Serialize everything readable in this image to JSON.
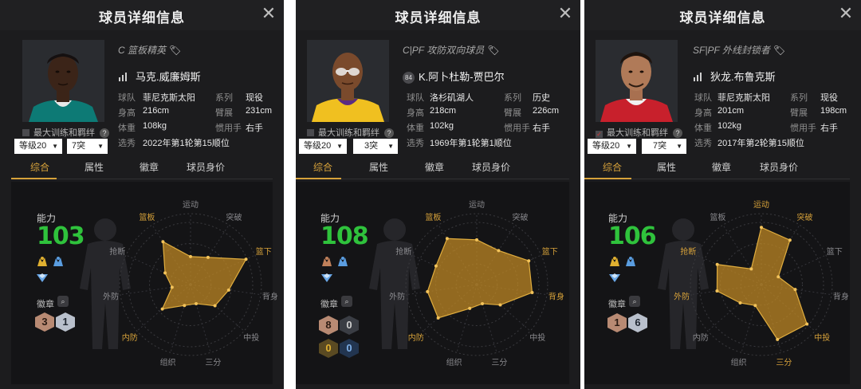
{
  "panels": [
    {
      "title": "球员详细信息",
      "position_line": "C 篮板精英",
      "name": "马克.威廉姆斯",
      "jersey_number": "",
      "info": {
        "team_label": "球队",
        "team": "菲尼克斯太阳",
        "series_label": "系列",
        "series": "现役",
        "height_label": "身高",
        "height": "216cm",
        "wingspan_label": "臂展",
        "wingspan": "231cm",
        "weight_label": "体重",
        "weight": "108kg",
        "hand_label": "惯用手",
        "hand": "右手",
        "draft_label": "选秀",
        "draft": "2022年第1轮第15顺位"
      },
      "training_label": "最大训练和羁绊",
      "training_checked": false,
      "level_select": "等级20",
      "break_select": "7突",
      "tabs": [
        "综合",
        "属性",
        "徽章",
        "球员身价"
      ],
      "ability_label": "能力",
      "ability": "103",
      "badges_label": "徽章",
      "badge_counts": [
        "3",
        "1"
      ],
      "radar": {
        "labels": [
          "运动",
          "突破",
          "篮下",
          "背身",
          "中投",
          "三分",
          "组织",
          "内防",
          "外防",
          "抢断",
          "篮板"
        ],
        "highlighted": [
          "篮下",
          "内防",
          "篮板"
        ],
        "values": [
          0.45,
          0.52,
          0.98,
          0.62,
          0.52,
          0.32,
          0.35,
          0.6,
          0.3,
          0.45,
          0.82
        ]
      }
    },
    {
      "title": "球员详细信息",
      "position_line": "C|PF 攻防双向球员",
      "name": "K.阿卜杜勒-贾巴尔",
      "jersey_number": "84",
      "info": {
        "team_label": "球队",
        "team": "洛杉矶湖人",
        "series_label": "系列",
        "series": "历史",
        "height_label": "身高",
        "height": "218cm",
        "wingspan_label": "臂展",
        "wingspan": "226cm",
        "weight_label": "体重",
        "weight": "102kg",
        "hand_label": "惯用手",
        "hand": "右手",
        "draft_label": "选秀",
        "draft": "1969年第1轮第1顺位"
      },
      "training_label": "最大训练和羁绊",
      "training_checked": false,
      "level_select": "等级20",
      "break_select": "3突",
      "tabs": [
        "综合",
        "属性",
        "徽章",
        "球员身价"
      ],
      "ability_label": "能力",
      "ability": "108",
      "badges_label": "徽章",
      "badge_counts": [
        "8",
        "0",
        "0",
        "0"
      ],
      "radar": {
        "labels": [
          "运动",
          "突破",
          "篮下",
          "背身",
          "中投",
          "三分",
          "组织",
          "内防",
          "外防",
          "抢断",
          "篮板"
        ],
        "highlighted": [
          "篮下",
          "背身",
          "内防",
          "篮板"
        ],
        "values": [
          0.72,
          0.65,
          0.92,
          0.9,
          0.5,
          0.32,
          0.4,
          0.82,
          0.8,
          0.72,
          0.88
        ]
      }
    },
    {
      "title": "球员详细信息",
      "position_line": "SF|PF 外线封锁者",
      "name": "狄龙.布鲁克斯",
      "jersey_number": "",
      "info": {
        "team_label": "球队",
        "team": "菲尼克斯太阳",
        "series_label": "系列",
        "series": "现役",
        "height_label": "身高",
        "height": "201cm",
        "wingspan_label": "臂展",
        "wingspan": "198cm",
        "weight_label": "体重",
        "weight": "102kg",
        "hand_label": "惯用手",
        "hand": "右手",
        "draft_label": "选秀",
        "draft": "2017年第2轮第15顺位"
      },
      "training_label": "最大训练和羁绊",
      "training_checked": true,
      "level_select": "等级20",
      "break_select": "7突",
      "tabs": [
        "综合",
        "属性",
        "徽章",
        "球员身价"
      ],
      "ability_label": "能力",
      "ability": "106",
      "badges_label": "徽章",
      "badge_counts": [
        "1",
        "6"
      ],
      "radar": {
        "labels": [
          "运动",
          "突破",
          "篮下",
          "背身",
          "中投",
          "三分",
          "组织",
          "内防",
          "外防",
          "抢断",
          "篮板"
        ],
        "highlighted": [
          "运动",
          "突破",
          "中投",
          "三分",
          "外防",
          "抢断"
        ],
        "values": [
          0.92,
          0.85,
          0.3,
          0.55,
          0.97,
          0.92,
          0.35,
          0.45,
          0.72,
          0.78,
          0.3
        ]
      }
    }
  ],
  "colors": {
    "accent": "#d7a23a",
    "ability": "#2fc23c",
    "radar_fill": "#c38a24",
    "panel_bg": "#1c1c1e"
  },
  "icons": [
    "close-icon",
    "tag-icon",
    "help-icon",
    "search-icon",
    "trait-icon"
  ]
}
